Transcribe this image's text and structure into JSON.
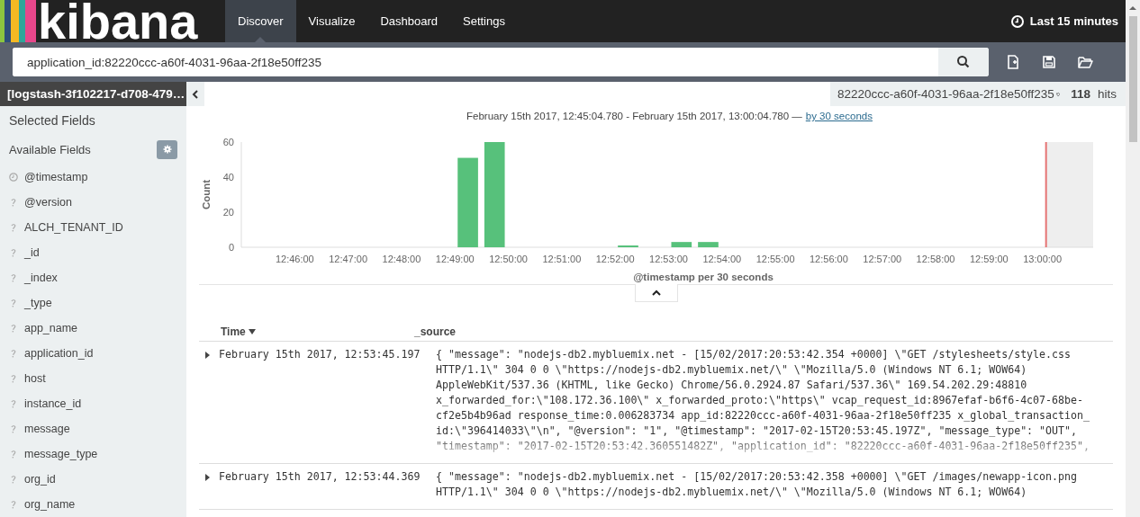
{
  "brand": {
    "logo_text": "kibana"
  },
  "nav": {
    "tabs": [
      {
        "label": "Discover",
        "selected": true
      },
      {
        "label": "Visualize",
        "selected": false
      },
      {
        "label": "Dashboard",
        "selected": false
      },
      {
        "label": "Settings",
        "selected": false
      }
    ],
    "time_picker": {
      "label": "Last 15 minutes"
    }
  },
  "query": {
    "value": "application_id:82220ccc-a60f-4031-96aa-2f18e50ff235"
  },
  "index_pattern": "[logstash-3f102217-d708-479…",
  "sidebar": {
    "selected_fields_title": "Selected Fields",
    "available_fields_title": "Available Fields",
    "fields": [
      {
        "name": "@timestamp",
        "kind": "date"
      },
      {
        "name": "@version",
        "kind": "unknown"
      },
      {
        "name": "ALCH_TENANT_ID",
        "kind": "unknown"
      },
      {
        "name": "_id",
        "kind": "unknown"
      },
      {
        "name": "_index",
        "kind": "unknown"
      },
      {
        "name": "_type",
        "kind": "unknown"
      },
      {
        "name": "app_name",
        "kind": "unknown"
      },
      {
        "name": "application_id",
        "kind": "unknown"
      },
      {
        "name": "host",
        "kind": "unknown"
      },
      {
        "name": "instance_id",
        "kind": "unknown"
      },
      {
        "name": "message",
        "kind": "unknown"
      },
      {
        "name": "message_type",
        "kind": "unknown"
      },
      {
        "name": "org_id",
        "kind": "unknown"
      },
      {
        "name": "org_name",
        "kind": "unknown"
      }
    ]
  },
  "hits": {
    "query": "82220ccc-a60f-4031-96aa-2f18e50ff235",
    "count": "118",
    "unit": "hits"
  },
  "range": {
    "text": "February 15th 2017, 12:45:04.780 - February 15th 2017, 13:00:04.780 —",
    "link": "by 30 seconds"
  },
  "histogram": {
    "chart_data": {
      "type": "bar",
      "xlabel": "@timestamp per 30 seconds",
      "ylabel": "Count",
      "categories": [
        null,
        null,
        "12:46:00",
        null,
        "12:47:00",
        null,
        "12:48:00",
        null,
        "12:49:00",
        null,
        "12:50:00",
        null,
        "12:51:00",
        null,
        "12:52:00",
        null,
        "12:53:00",
        null,
        "12:54:00",
        null,
        "12:55:00",
        null,
        "12:56:00",
        null,
        "12:57:00",
        null,
        "12:58:00",
        null,
        "12:59:00",
        null,
        "13:00:00"
      ],
      "series": [
        {
          "color": "#57c17b",
          "values": [
            0,
            0,
            0,
            0,
            0,
            0,
            0,
            0,
            51,
            60,
            0,
            0,
            0,
            0,
            1,
            0,
            3,
            3,
            0,
            0,
            0,
            0,
            0,
            0,
            0,
            0,
            0,
            0,
            0,
            0,
            0
          ]
        }
      ],
      "ylim": [
        0,
        60
      ],
      "yticks": [
        0,
        20,
        40,
        60
      ]
    }
  },
  "table": {
    "columns": [
      {
        "label": "Time",
        "sorted": true
      },
      {
        "label": "_source",
        "sorted": false
      }
    ],
    "rows": [
      {
        "expanded": false,
        "truncated": true,
        "time": "February 15th 2017, 12:53:45.197",
        "source_lines": [
          "{ \"message\": \"nodejs-db2.mybluemix.net - [15/02/2017:20:53:42.354 +0000] \\\"GET /stylesheets/style.css",
          "HTTP/1.1\\\" 304 0 0 \\\"https://nodejs-db2.mybluemix.net/\\\" \\\"Mozilla/5.0 (Windows NT 6.1; WOW64)",
          "AppleWebKit/537.36 (KHTML, like Gecko) Chrome/56.0.2924.87 Safari/537.36\\\" 169.54.202.29:48810",
          "x_forwarded_for:\\\"108.172.36.100\\\" x_forwarded_proto:\\\"https\\\" vcap_request_id:8967efaf-b6f6-4c07-68be-",
          "cf2e5b4b96ad response_time:0.006283734 app_id:82220ccc-a60f-4031-96aa-2f18e50ff235 x_global_transaction_",
          "id:\\\"396414033\\\"\\n\", \"@version\": \"1\", \"@timestamp\": \"2017-02-15T20:53:45.197Z\", \"message_type\": \"OUT\",",
          "\"timestamp\": \"2017-02-15T20:53:42.360551482Z\", \"application_id\": \"82220ccc-a60f-4031-96aa-2f18e50ff235\","
        ]
      },
      {
        "expanded": false,
        "truncated": false,
        "time": "February 15th 2017, 12:53:44.369",
        "source_lines": [
          "{ \"message\": \"nodejs-db2.mybluemix.net - [15/02/2017:20:53:42.358 +0000] \\\"GET /images/newapp-icon.png",
          "HTTP/1.1\\\" 304 0 0 \\\"https://nodejs-db2.mybluemix.net/\\\" \\\"Mozilla/5.0 (Windows NT 6.1; WOW64)"
        ]
      }
    ]
  }
}
